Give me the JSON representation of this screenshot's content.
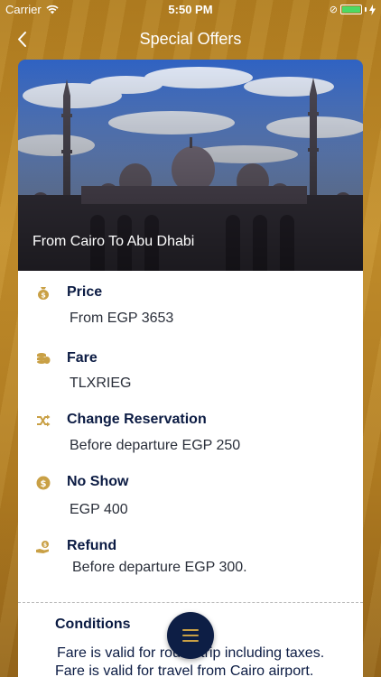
{
  "status_bar": {
    "carrier": "Carrier",
    "time": "5:50 PM"
  },
  "nav": {
    "title": "Special Offers"
  },
  "hero": {
    "title": "From Cairo To Abu Dhabi"
  },
  "details": [
    {
      "icon": "money-bag-icon",
      "label": "Price",
      "value": "From EGP 3653"
    },
    {
      "icon": "coins-icon",
      "label": "Fare",
      "value": "TLXRIEG"
    },
    {
      "icon": "shuffle-icon",
      "label": "Change Reservation",
      "value": "Before departure EGP 250"
    },
    {
      "icon": "dollar-coin-icon",
      "label": "No Show",
      "value": "EGP 400"
    },
    {
      "icon": "refund-icon",
      "label": "Refund",
      "value": "Before departure EGP 300."
    }
  ],
  "conditions": {
    "title": "Conditions",
    "lines": [
      "Fare is valid for round trip including taxes.",
      "Fare is valid for travel from Cairo airport."
    ]
  },
  "colors": {
    "gold": "#c9a045",
    "navy": "#0b1b43",
    "battery": "#4cd964"
  }
}
